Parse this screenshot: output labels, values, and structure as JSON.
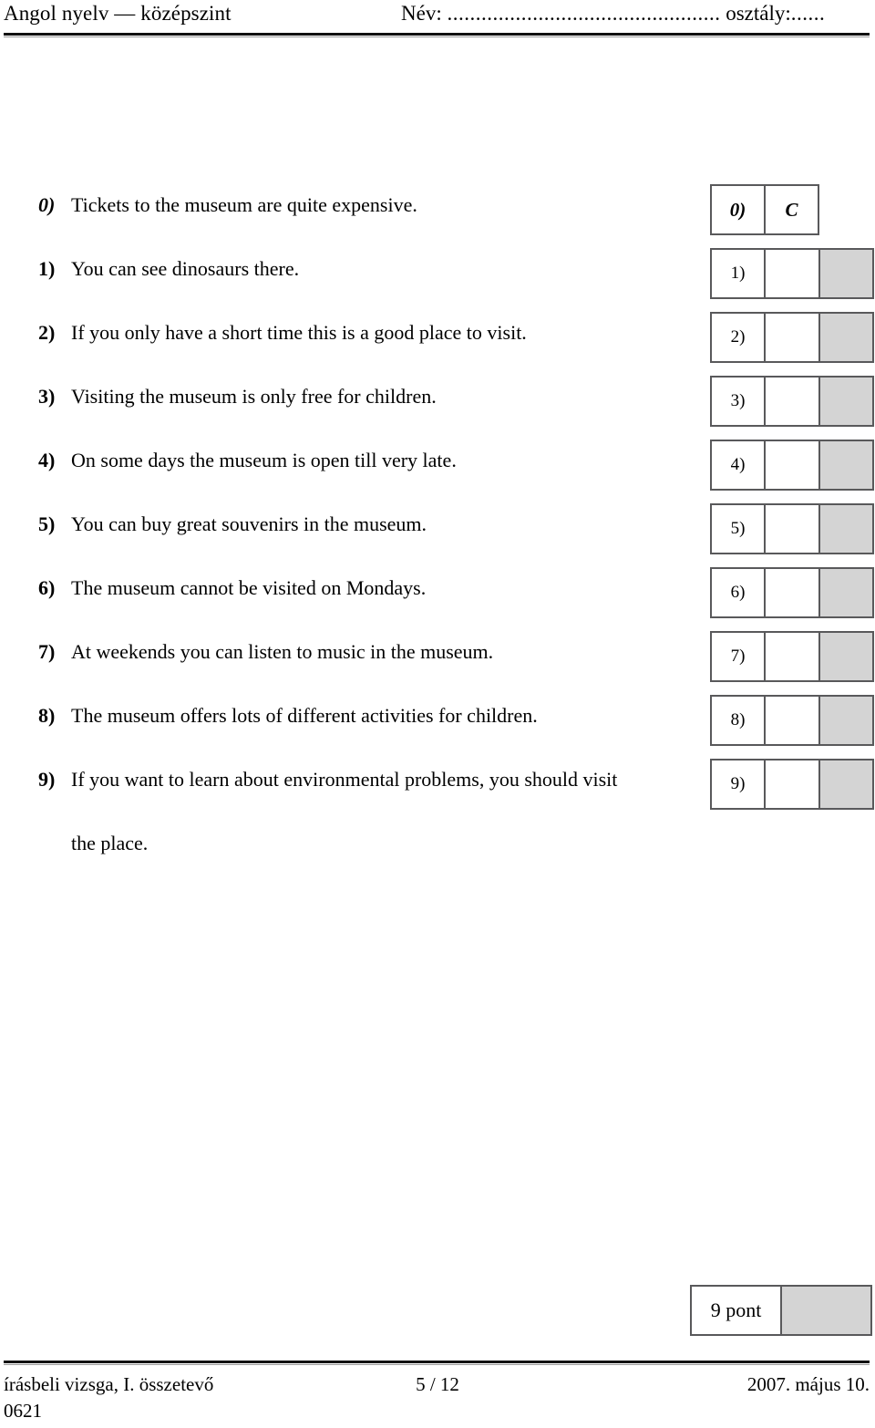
{
  "header": {
    "subject": "Angol nyelv — középszint",
    "name_label": "Név:",
    "name_dots": "................................................",
    "class_label": "osztály:",
    "class_dots": "......"
  },
  "task": {
    "example": {
      "number": "0)",
      "text": "Tickets to the museum are quite expensive.",
      "box_number": "0)",
      "answer": "C"
    },
    "items": [
      {
        "number": "1)",
        "text": "You can see dinosaurs there.",
        "box_number": "1)",
        "answer": ""
      },
      {
        "number": "2)",
        "text": "If you only have a short time this is a good place to visit.",
        "box_number": "2)",
        "answer": ""
      },
      {
        "number": "3)",
        "text": "Visiting the museum is only free for children.",
        "box_number": "3)",
        "answer": ""
      },
      {
        "number": "4)",
        "text": "On some days the museum is open till very late.",
        "box_number": "4)",
        "answer": ""
      },
      {
        "number": "5)",
        "text": "You can buy great souvenirs in the museum.",
        "box_number": "5)",
        "answer": ""
      },
      {
        "number": "6)",
        "text": "The museum cannot be visited on Mondays.",
        "box_number": "6)",
        "answer": ""
      },
      {
        "number": "7)",
        "text": "At weekends you can listen to music in the museum.",
        "box_number": "7)",
        "answer": ""
      },
      {
        "number": "8)",
        "text": "The museum offers lots of different activities for children.",
        "box_number": "8)",
        "answer": ""
      },
      {
        "number": "9)",
        "text": "If you want to learn about environmental problems, you should visit",
        "text_cont": "the place.",
        "box_number": "9)",
        "answer": ""
      }
    ]
  },
  "points": {
    "label": "9 pont",
    "score": ""
  },
  "footer": {
    "left": "írásbeli vizsga, I. összetevő",
    "code": "0621",
    "center": "5 / 12",
    "right": "2007. május 10."
  },
  "colors": {
    "shaded_cell": "#d4d4d4",
    "border": "#59595b",
    "rule": "#111111"
  }
}
